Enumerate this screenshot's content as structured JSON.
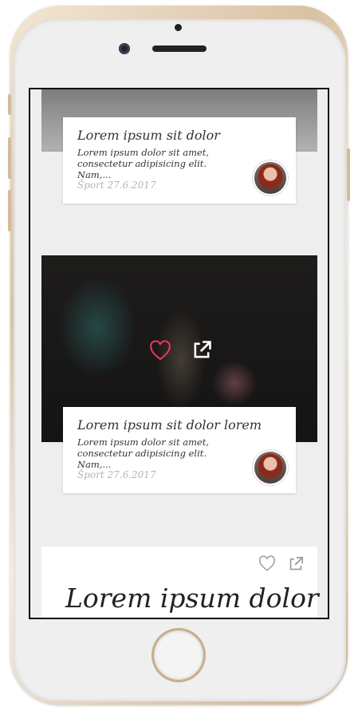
{
  "cards": [
    {
      "title": "Lorem ipsum sit dolor",
      "excerpt": "Lorem ipsum dolor sit amet, consectetur adipisicing elit. Nam,...",
      "meta": "Šport 27.6.2017"
    },
    {
      "title": "Lorem ipsum sit dolor lorem",
      "excerpt": "Lorem ipsum dolor sit amet, consectetur adipisicing elit. Nam,...",
      "meta": "Šport 27.6.2017"
    },
    {
      "title": "Lorem ipsum dolor"
    }
  ],
  "icons": {
    "like": "heart-icon",
    "share": "external-link-icon"
  },
  "colors": {
    "like_active": "#e8345a",
    "icon_light": "#ffffff",
    "icon_dark": "#9a9a9a",
    "meta_text": "#b5b5b5"
  }
}
